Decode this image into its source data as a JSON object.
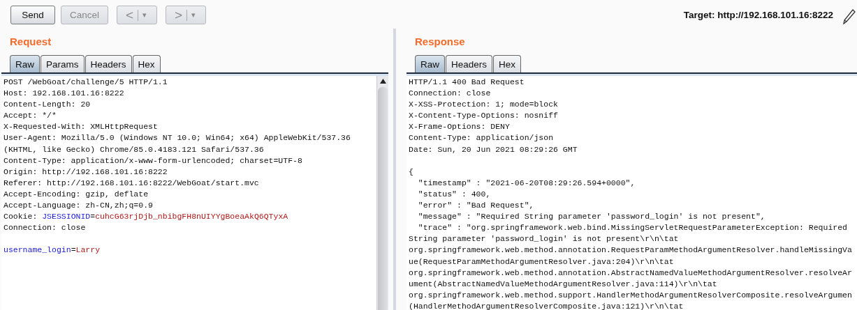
{
  "toolbar": {
    "buttons": [
      {
        "label": "Send",
        "disabled": false
      },
      {
        "label": "Cancel",
        "disabled": true
      }
    ],
    "history": [
      {
        "label": "<",
        "menu": "▾",
        "disabled": true
      },
      {
        "label": ">",
        "menu": "▾",
        "disabled": true
      }
    ],
    "target": "Target: http://192.168.101.16:8222"
  },
  "request": {
    "title": "Request",
    "tabs": [
      {
        "label": "Raw",
        "selected": true
      },
      {
        "label": "Params",
        "selected": false
      },
      {
        "label": "Headers",
        "selected": false
      },
      {
        "label": "Hex",
        "selected": false
      }
    ],
    "headers": [
      [
        {
          "text": "POST /WebGoat/challenge/5 HTTP/1.1"
        }
      ],
      [
        {
          "text": "Host: 192.168.101.16:8222"
        }
      ],
      [
        {
          "text": "Content-Length: 20"
        }
      ],
      [
        {
          "text": "Accept: */*"
        }
      ],
      [
        {
          "text": "X-Requested-With: XMLHttpRequest"
        }
      ],
      [
        {
          "text": "User-Agent: Mozilla/5.0 (Windows NT 10.0; Win64; x64) AppleWebKit/537.36"
        }
      ],
      [
        {
          "text": "(KHTML, like Gecko) Chrome/85.0.4183.121 Safari/537.36"
        }
      ],
      [
        {
          "text": "Content-Type: application/x-www-form-urlencoded; charset=UTF-8"
        }
      ],
      [
        {
          "text": "Origin: http://192.168.101.16:8222"
        }
      ],
      [
        {
          "text": "Referer: http://192.168.101.16:8222/WebGoat/start.mvc"
        }
      ],
      [
        {
          "text": "Accept-Encoding: gzip, deflate"
        }
      ],
      [
        {
          "text": "Accept-Language: zh-CN,zh;q=0.9"
        }
      ],
      [
        {
          "text": "Cookie: "
        },
        {
          "text": "JSESSIONID",
          "kind": "name"
        },
        {
          "text": "="
        },
        {
          "text": "cuhcG63rjDjb_nbibgFH8nUIYYgBoeaAkQ6QTyxA",
          "kind": "value"
        }
      ],
      [
        {
          "text": "Connection: close"
        }
      ]
    ],
    "body": [
      [
        {
          "text": "username_login",
          "kind": "name"
        },
        {
          "text": "="
        },
        {
          "text": "Larry",
          "kind": "value"
        }
      ]
    ]
  },
  "response": {
    "title": "Response",
    "tabs": [
      {
        "label": "Raw",
        "selected": true
      },
      {
        "label": "Headers",
        "selected": false
      },
      {
        "label": "Hex",
        "selected": false
      }
    ],
    "headers": [
      [
        {
          "text": "HTTP/1.1 400 Bad Request"
        }
      ],
      [
        {
          "text": "Connection: close"
        }
      ],
      [
        {
          "text": "X-XSS-Protection: 1; mode=block"
        }
      ],
      [
        {
          "text": "X-Content-Type-Options: nosniff"
        }
      ],
      [
        {
          "text": "X-Frame-Options: DENY"
        }
      ],
      [
        {
          "text": "Content-Type: application/json"
        }
      ],
      [
        {
          "text": "Date: Sun, 20 Jun 2021 08:29:26 GMT"
        }
      ]
    ],
    "body": [
      [
        {
          "text": "{"
        }
      ],
      [
        {
          "text": "  \"timestamp\" : \"2021-06-20T08:29:26.594+0000\","
        }
      ],
      [
        {
          "text": "  \"status\" : 400,"
        }
      ],
      [
        {
          "text": "  \"error\" : \"Bad Request\","
        }
      ],
      [
        {
          "text": "  \"message\" : \"Required String parameter 'password_login' is not present\","
        }
      ],
      [
        {
          "text": "  \"trace\" : \"org.springframework.web.bind.MissingServletRequestParameterException: Required"
        }
      ],
      [
        {
          "text": "String parameter 'password_login' is not present\\r\\n\\tat"
        }
      ],
      [
        {
          "text": "org.springframework.web.method.annotation.RequestParamMethodArgumentResolver.handleMissingVa"
        }
      ],
      [
        {
          "text": "ue(RequestParamMethodArgumentResolver.java:204)\\r\\n\\tat"
        }
      ],
      [
        {
          "text": "org.springframework.web.method.annotation.AbstractNamedValueMethodArgumentResolver.resolveAr"
        }
      ],
      [
        {
          "text": "ument(AbstractNamedValueMethodArgumentResolver.java:114)\\r\\n\\tat"
        }
      ],
      [
        {
          "text": "org.springframework.web.method.support.HandlerMethodArgumentResolverComposite.resolveArgumen"
        }
      ],
      [
        {
          "text": "(HandlerMethodArgumentResolverComposite.java:121)\\r\\n\\tat"
        }
      ]
    ]
  }
}
